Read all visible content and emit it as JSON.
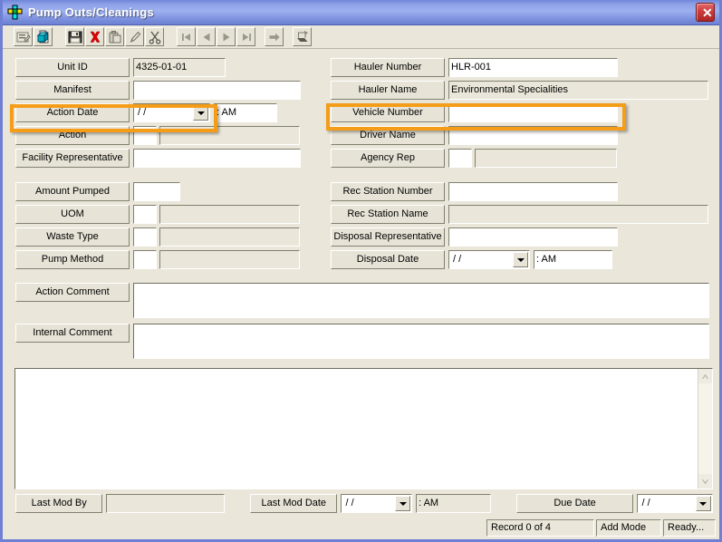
{
  "window": {
    "title": "Pump Outs/Cleanings",
    "close_label": "✕",
    "app_icon": "pump-icon",
    "border_color": "#6f7fd4",
    "titlebar_color": "#8fa2e8",
    "face_color": "#eae7da",
    "highlight_color": "#f59d18"
  },
  "toolbar": {
    "buttons": [
      {
        "name": "properties-icon",
        "tip": "Properties"
      },
      {
        "name": "copy-record-icon",
        "tip": "Copy Record"
      },
      {
        "name": "save-icon",
        "tip": "Save"
      },
      {
        "name": "delete-icon",
        "tip": "Delete"
      },
      {
        "name": "paste-icon",
        "tip": "Paste"
      },
      {
        "name": "edit-icon",
        "tip": "Edit"
      },
      {
        "name": "cut-icon",
        "tip": "Cut"
      },
      {
        "name": "first-record-icon",
        "tip": "First Record"
      },
      {
        "name": "previous-record-icon",
        "tip": "Previous Record"
      },
      {
        "name": "next-record-icon",
        "tip": "Next Record"
      },
      {
        "name": "last-record-icon",
        "tip": "Last Record"
      },
      {
        "name": "goto-record-icon",
        "tip": "Go To Record"
      },
      {
        "name": "print-icon",
        "tip": "Print"
      }
    ]
  },
  "form": {
    "left_column": {
      "unit_id": {
        "label": "Unit ID",
        "value": "4325-01-01",
        "readonly": true
      },
      "manifest": {
        "label": "Manifest",
        "value": ""
      },
      "action_date": {
        "label": "Action Date",
        "value": "/  /",
        "time_value": ":   AM",
        "highlighted": true
      },
      "action": {
        "label": "Action",
        "code": "",
        "desc": ""
      },
      "facility_representative": {
        "label": "Facility Representative",
        "value": ""
      },
      "amount_pumped": {
        "label": "Amount Pumped",
        "value": ""
      },
      "uom": {
        "label": "UOM",
        "code": "",
        "desc": ""
      },
      "waste_type": {
        "label": "Waste Type",
        "code": "",
        "desc": ""
      },
      "pump_method": {
        "label": "Pump Method",
        "code": "",
        "desc": ""
      }
    },
    "right_column": {
      "hauler_number": {
        "label": "Hauler Number",
        "value": "HLR-001"
      },
      "hauler_name": {
        "label": "Hauler Name",
        "value": "Environmental Specialities",
        "readonly": true
      },
      "vehicle_number": {
        "label": "Vehicle Number",
        "value": "",
        "highlighted": true
      },
      "driver_name": {
        "label": "Driver Name",
        "value": ""
      },
      "agency_rep": {
        "label": "Agency Rep",
        "code": "",
        "desc": ""
      },
      "rec_station_number": {
        "label": "Rec Station Number",
        "value": ""
      },
      "rec_station_name": {
        "label": "Rec Station Name",
        "value": "",
        "readonly": true
      },
      "disposal_representative": {
        "label": "Disposal Representative",
        "value": ""
      },
      "disposal_date": {
        "label": "Disposal Date",
        "value": "/  /",
        "time_value": ":   AM"
      }
    },
    "comments": {
      "action_comment": {
        "label": "Action Comment",
        "value": ""
      },
      "internal_comment": {
        "label": "Internal Comment",
        "value": ""
      }
    },
    "notes": {
      "value": ""
    }
  },
  "footer": {
    "last_mod_by": {
      "label": "Last Mod By",
      "value": ""
    },
    "last_mod_date": {
      "label": "Last Mod Date",
      "value": "/  /",
      "time_value": ":   AM"
    },
    "due_date": {
      "label": "Due Date",
      "value": "/  /"
    }
  },
  "statusbar": {
    "record": "Record 0 of 4",
    "mode": "Add Mode",
    "state": "Ready..."
  }
}
